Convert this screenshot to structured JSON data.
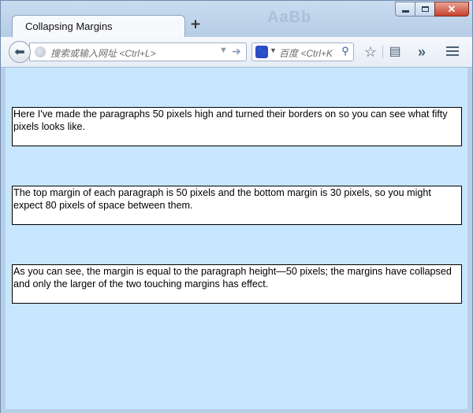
{
  "browser": {
    "tab_title": "Collapsing Margins",
    "new_tab_label": "+",
    "aero_text": "AaBb",
    "url_placeholder": "搜索或输入网址 <Ctrl+L>",
    "search_engine_label": "百度",
    "search_placeholder": "百度 <Ctrl+K"
  },
  "icons": {
    "back": "back-arrow-icon",
    "globe": "globe-icon",
    "dropdown": "chevron-down-icon",
    "go": "go-arrow-icon",
    "search": "search-icon",
    "bookmark": "star-icon",
    "reading_list": "reading-list-icon",
    "overflow": "overflow-chevrons-icon",
    "menu": "hamburger-menu-icon",
    "minimize": "minimize-icon",
    "maximize": "maximize-icon",
    "close": "close-icon"
  },
  "colors": {
    "page_background": "#c8e6fe",
    "paragraph_background": "#ffffff",
    "paragraph_border": "#000000",
    "close_button": "#c7422c"
  },
  "page": {
    "paragraphs": [
      "Here I've made the paragraphs 50 pixels high and turned their borders on so you can see what fifty pixels looks like.",
      "The top margin of each paragraph is 50 pixels and the bottom margin is 30 pixels, so you might expect 80 pixels of space between them.",
      "As you can see, the margin is equal to the paragraph height—50 pixels; the margins have collapsed and only the larger of the two touching margins has effect."
    ]
  }
}
